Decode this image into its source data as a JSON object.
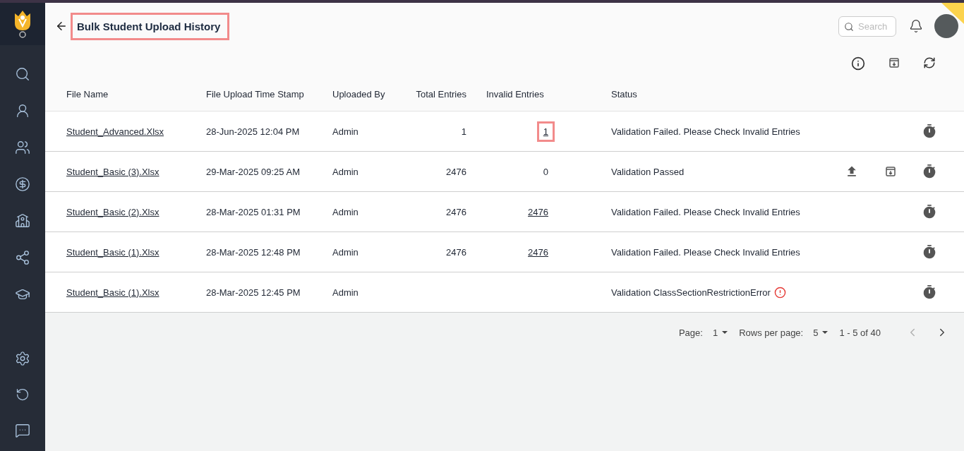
{
  "header": {
    "title": "Bulk Student Upload History",
    "title_highlighted": true
  },
  "search": {
    "placeholder": "Search"
  },
  "table": {
    "columns": [
      "File Name",
      "File Upload Time Stamp",
      "Uploaded By",
      "Total Entries",
      "Invalid Entries",
      "Status"
    ],
    "rows": [
      {
        "file_name": "Student_Advanced.Xlsx",
        "timestamp": "28-Jun-2025 12:04 PM",
        "uploaded_by": "Admin",
        "total_entries": "1",
        "invalid_entries": "1",
        "invalid_linked": true,
        "invalid_highlighted": true,
        "status": "Validation Failed. Please Check Invalid Entries",
        "status_error": false,
        "can_upload": false,
        "can_download": false
      },
      {
        "file_name": "Student_Basic (3).Xlsx",
        "timestamp": "29-Mar-2025 09:25 AM",
        "uploaded_by": "Admin",
        "total_entries": "2476",
        "invalid_entries": "0",
        "invalid_linked": false,
        "invalid_highlighted": false,
        "status": "Validation Passed",
        "status_error": false,
        "can_upload": true,
        "can_download": true
      },
      {
        "file_name": "Student_Basic (2).Xlsx",
        "timestamp": "28-Mar-2025 01:31 PM",
        "uploaded_by": "Admin",
        "total_entries": "2476",
        "invalid_entries": "2476",
        "invalid_linked": true,
        "invalid_highlighted": false,
        "status": "Validation Failed. Please Check Invalid Entries",
        "status_error": false,
        "can_upload": false,
        "can_download": false
      },
      {
        "file_name": "Student_Basic (1).Xlsx",
        "timestamp": "28-Mar-2025 12:48 PM",
        "uploaded_by": "Admin",
        "total_entries": "2476",
        "invalid_entries": "2476",
        "invalid_linked": true,
        "invalid_highlighted": false,
        "status": "Validation Failed. Please Check Invalid Entries",
        "status_error": false,
        "can_upload": false,
        "can_download": false
      },
      {
        "file_name": "Student_Basic (1).Xlsx",
        "timestamp": "28-Mar-2025 12:45 PM",
        "uploaded_by": "Admin",
        "status": "Validation ClassSectionRestrictionError",
        "status_error": true,
        "can_upload": false,
        "can_download": false
      }
    ]
  },
  "pagination": {
    "page_label": "Page:",
    "page": "1",
    "rows_label": "Rows per page:",
    "rows": "5",
    "range": "1 - 5 of 40",
    "prev_disabled": true,
    "next_disabled": false
  }
}
